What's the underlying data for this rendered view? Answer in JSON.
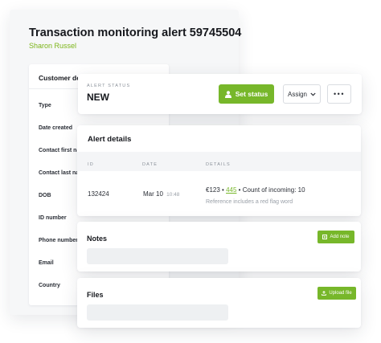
{
  "back_panel": {
    "title": "Transaction monitoring alert 59745504",
    "subtitle": "Sharon Russel",
    "customer_card": {
      "header": "Customer de",
      "fields": [
        "Type",
        "Date created",
        "Contact first nar",
        "Contact last nar",
        "DOB",
        "ID number",
        "Phone number",
        "Email",
        "Country"
      ]
    }
  },
  "status_card": {
    "label": "ALERT STATUS",
    "value": "NEW",
    "set_status_label": "Set status",
    "assign_label": "Assign",
    "more_label": "•••"
  },
  "alert_details": {
    "title": "Alert details",
    "columns": [
      "ID",
      "DATE",
      "DETAILS"
    ],
    "row": {
      "id": "132424",
      "date": "Mar 10",
      "time": "10:48",
      "amount": "€123",
      "sep1": "•",
      "link": "445",
      "sep2": "•",
      "count": "Count of incoming: 10",
      "subtext": "Reference includes a red flag word"
    }
  },
  "notes": {
    "title": "Notes",
    "button_label": "Add note"
  },
  "files": {
    "title": "Files",
    "button_label": "Upload file"
  },
  "colors": {
    "accent": "#77b72a",
    "subtitle_green": "#7cb518",
    "muted": "#8a9099"
  },
  "icons": {
    "set_status": "user-icon",
    "assign": "chevron-down-icon",
    "add_note": "note-icon",
    "upload": "upload-icon"
  }
}
